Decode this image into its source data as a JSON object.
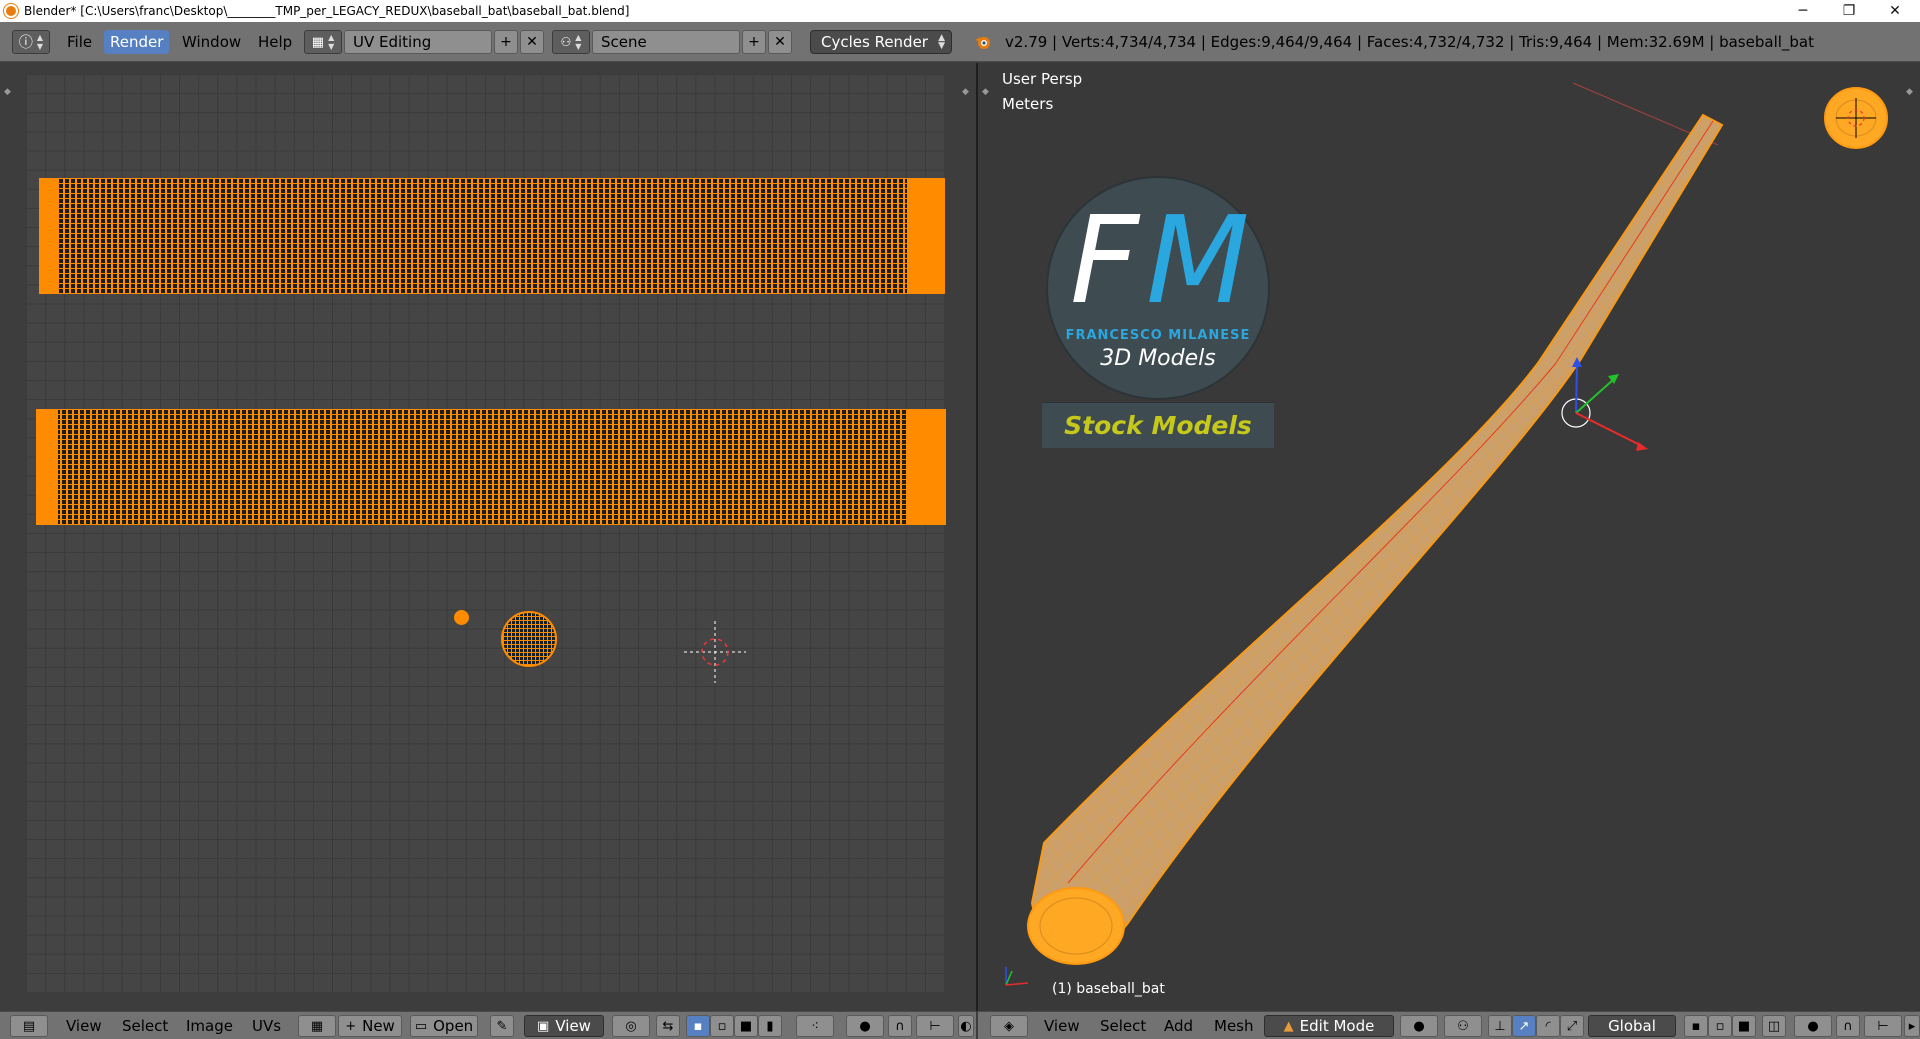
{
  "window": {
    "title": "Blender* [C:\\Users\\franc\\Desktop\\________TMP_per_LEGACY_REDUX\\baseball_bat\\baseball_bat.blend]",
    "minimize": "─",
    "restore": "❐",
    "close": "✕"
  },
  "header": {
    "info_icon": "ⓘ",
    "menus": [
      "File",
      "Render",
      "Window",
      "Help"
    ],
    "active_menu": "Render",
    "screen_layout": "UV Editing",
    "scene": "Scene",
    "render_engine": "Cycles Render",
    "stats": "v2.79 | Verts:4,734/4,734 | Edges:9,464/9,464 | Faces:4,732/4,732 | Tris:9,464 | Mem:32.69M | baseball_bat",
    "add_symbol": "+",
    "remove_symbol": "✕"
  },
  "viewport": {
    "view_name": "User Persp",
    "units": "Meters",
    "object_label": "(1) baseball_bat",
    "logo": {
      "letter_f": "F",
      "letter_m": "M",
      "brand": "FRANCESCO MILANESE",
      "tagline": "3D Models",
      "banner": "Stock Models"
    }
  },
  "uv_footer": {
    "menus": [
      "View",
      "Select",
      "Image",
      "UVs"
    ],
    "new_label": "New",
    "open_label": "Open",
    "view_label": "View"
  },
  "viewport_footer": {
    "menus": [
      "View",
      "Select",
      "Add",
      "Mesh"
    ],
    "mode": "Edit Mode",
    "orientation": "Global"
  },
  "colors": {
    "accent": "#5680c2",
    "uv_selected": "#ff8c00",
    "header_bg": "#727272",
    "viewport_bg": "#393939"
  }
}
